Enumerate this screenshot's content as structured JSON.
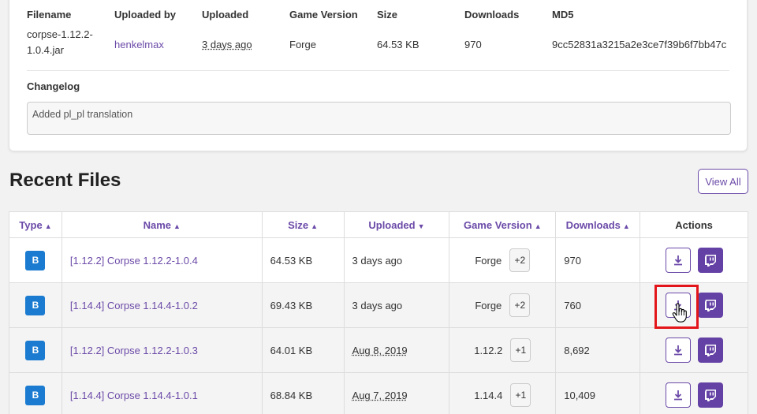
{
  "file_details": {
    "headers": {
      "filename": "Filename",
      "uploaded_by": "Uploaded by",
      "uploaded": "Uploaded",
      "game_version": "Game Version",
      "size": "Size",
      "downloads": "Downloads",
      "md5": "MD5"
    },
    "values": {
      "filename": "corpse-1.12.2-1.0.4.jar",
      "uploaded_by": "henkelmax",
      "uploaded": "3 days ago",
      "game_version": "Forge",
      "size": "64.53 KB",
      "downloads": "970",
      "md5": "9cc52831a3215a2e3ce7f39b6f7bb47c"
    },
    "changelog_label": "Changelog",
    "changelog_text": "Added pl_pl translation"
  },
  "recent_files": {
    "title": "Recent Files",
    "view_all_label": "View All",
    "columns": {
      "type": "Type",
      "name": "Name",
      "size": "Size",
      "uploaded": "Uploaded",
      "game_version": "Game Version",
      "downloads": "Downloads",
      "actions": "Actions"
    },
    "rows": [
      {
        "type": "B",
        "name": "[1.12.2] Corpse 1.12.2-1.0.4",
        "size": "64.53 KB",
        "uploaded": "3 days ago",
        "game_version": "Forge",
        "extra": "+2",
        "downloads": "970"
      },
      {
        "type": "B",
        "name": "[1.14.4] Corpse 1.14.4-1.0.2",
        "size": "69.43 KB",
        "uploaded": "3 days ago",
        "game_version": "Forge",
        "extra": "+2",
        "downloads": "760"
      },
      {
        "type": "B",
        "name": "[1.12.2] Corpse 1.12.2-1.0.3",
        "size": "64.01 KB",
        "uploaded": "Aug 8, 2019",
        "game_version": "1.12.2",
        "extra": "+1",
        "downloads": "8,692"
      },
      {
        "type": "B",
        "name": "[1.14.4] Corpse 1.14.4-1.0.1",
        "size": "68.84 KB",
        "uploaded": "Aug 7, 2019",
        "game_version": "1.14.4",
        "extra": "+1",
        "downloads": "10,409"
      }
    ]
  },
  "icons": {
    "sort": "sort-icon",
    "download": "download-icon",
    "twitch": "twitch-icon",
    "cursor": "hand-pointer-icon"
  },
  "colors": {
    "accent": "#6b4aa8",
    "twitch": "#6441a5",
    "type_badge": "#1a7bd0",
    "highlight": "#e3151a"
  }
}
